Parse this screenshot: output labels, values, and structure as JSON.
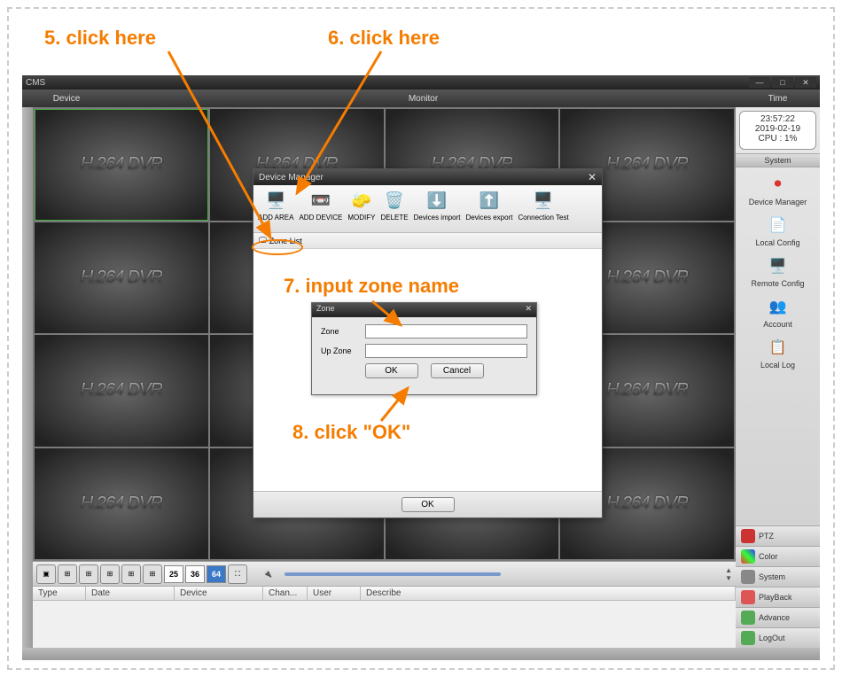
{
  "annotations": {
    "step5": "5. click here",
    "step6": "6. click here",
    "step7": "7. input zone name",
    "step8": "8. click \"OK\""
  },
  "titlebar": {
    "app_name": "CMS"
  },
  "headerbar": {
    "device": "Device",
    "monitor": "Monitor",
    "time": "Time"
  },
  "video_cell_text": "H.264 DVR",
  "time_box": {
    "time": "23:57:22",
    "date": "2019-02-19",
    "cpu": "CPU : 1%"
  },
  "right_panel": {
    "system_header": "System",
    "items": [
      {
        "label": "Device Manager"
      },
      {
        "label": "Local Config"
      },
      {
        "label": "Remote Config"
      },
      {
        "label": "Account"
      },
      {
        "label": "Local Log"
      }
    ]
  },
  "side_tabs": [
    {
      "label": "PTZ"
    },
    {
      "label": "Color"
    },
    {
      "label": "System"
    },
    {
      "label": "PlayBack"
    },
    {
      "label": "Advance"
    },
    {
      "label": "LogOut"
    }
  ],
  "toolbar_labels": {
    "l25": "25",
    "l36": "36",
    "l64": "64"
  },
  "log_columns": [
    "Type",
    "Date",
    "Device",
    "Chan...",
    "User",
    "Describe"
  ],
  "device_manager": {
    "title": "Device Manager",
    "buttons": [
      "ADD AREA",
      "ADD DEVICE",
      "MODIFY",
      "DELETE",
      "Devices import",
      "Devices export",
      "Connection Test"
    ],
    "tree_root": "Zone List",
    "ok": "OK"
  },
  "zone_dialog": {
    "title": "Zone",
    "zone_label": "Zone",
    "upzone_label": "Up Zone",
    "zone_value": "",
    "upzone_value": "",
    "ok": "OK",
    "cancel": "Cancel"
  }
}
